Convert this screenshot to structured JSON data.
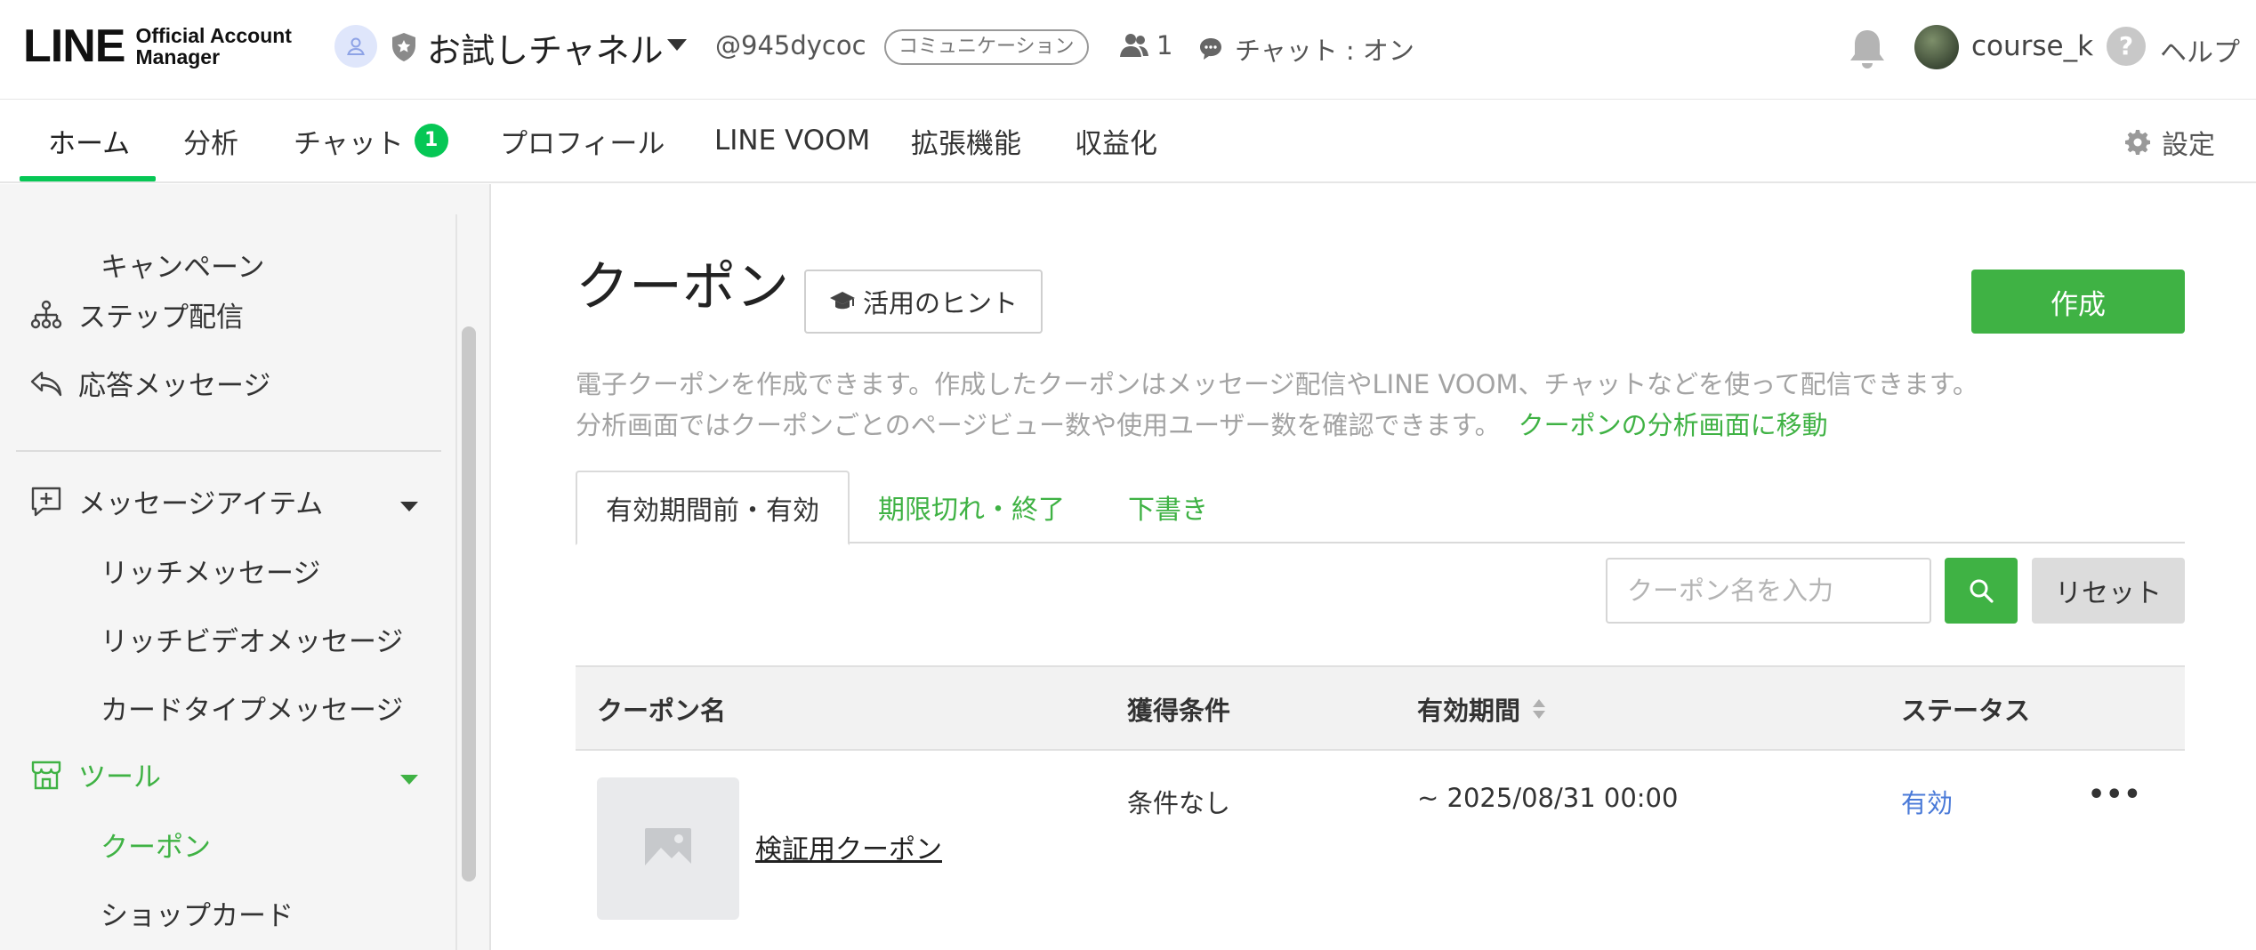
{
  "header": {
    "logo_main": "LINE",
    "logo_sub_1": "Official Account",
    "logo_sub_2": "Manager",
    "account_name": "お試しチャネル",
    "account_id": "@945dycoc",
    "account_category": "コミュニケーション",
    "friends_count": "1",
    "chat_status": "チャット : オン",
    "user_name": "course_k",
    "help_label": "ヘルプ",
    "help_glyph": "?"
  },
  "nav": {
    "items": [
      {
        "label": "ホーム",
        "active": true
      },
      {
        "label": "分析"
      },
      {
        "label": "チャット",
        "badge": "1"
      },
      {
        "label": "プロフィール"
      },
      {
        "label": "LINE VOOM"
      },
      {
        "label": "拡張機能"
      },
      {
        "label": "収益化"
      }
    ],
    "settings_label": "設定"
  },
  "sidebar": {
    "items": [
      {
        "label": "キャンペーン",
        "type": "sub"
      },
      {
        "label": "ステップ配信",
        "icon": "step-flow-icon"
      },
      {
        "label": "応答メッセージ",
        "icon": "reply-icon"
      },
      {
        "label": "メッセージアイテム",
        "icon": "message-plus-icon",
        "expanded": true
      },
      {
        "label": "リッチメッセージ",
        "type": "sub"
      },
      {
        "label": "リッチビデオメッセージ",
        "type": "sub"
      },
      {
        "label": "カードタイプメッセージ",
        "type": "sub"
      },
      {
        "label": "ツール",
        "icon": "store-icon",
        "expanded": true,
        "active": true
      },
      {
        "label": "クーポン",
        "type": "sub",
        "active": true
      },
      {
        "label": "ショップカード",
        "type": "sub"
      }
    ]
  },
  "main": {
    "title": "クーポン",
    "hint_button": "活用のヒント",
    "create_button": "作成",
    "description_1": "電子クーポンを作成できます。作成したクーポンはメッセージ配信やLINE VOOM、チャットなどを使って配信できます。",
    "description_2": "分析画面ではクーポンごとのページビュー数や使用ユーザー数を確認できます。",
    "analysis_link": "クーポンの分析画面に移動",
    "tabs": [
      {
        "label": "有効期間前・有効",
        "active": true
      },
      {
        "label": "期限切れ・終了"
      },
      {
        "label": "下書き"
      }
    ],
    "search_placeholder": "クーポン名を入力",
    "reset_button": "リセット",
    "table": {
      "columns": [
        "クーポン名",
        "獲得条件",
        "有効期間",
        "ステータス"
      ],
      "rows": [
        {
          "name": "検証用クーポン",
          "condition": "条件なし",
          "period": "~ 2025/08/31 00:00",
          "status": "有効",
          "more": "•••"
        }
      ]
    }
  },
  "colors": {
    "brand_green": "#06c755",
    "accent_green": "#3fb244",
    "status_blue": "#4a7ad8"
  }
}
